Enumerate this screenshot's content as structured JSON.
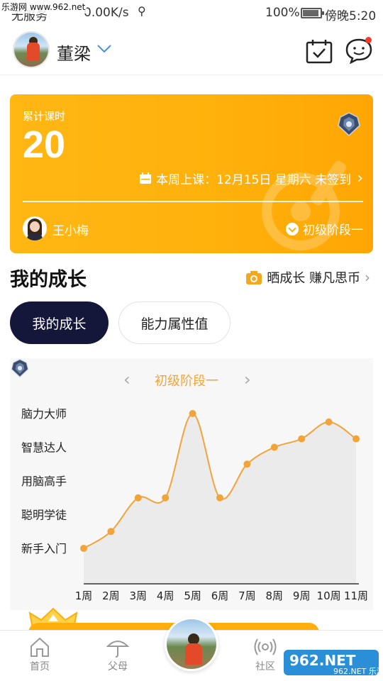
{
  "watermark_top": "乐游网 www.962.net",
  "status_bar": {
    "carrier": "无服务",
    "speed": "0.00K/s",
    "usb_icon": "usb-icon",
    "battery_pct": "100%",
    "time": "傍晚5:20"
  },
  "header": {
    "user_name": "董梁",
    "calendar_icon": "calendar-check-icon",
    "chat_icon": "chat-bubble-icon"
  },
  "card": {
    "hours_label": "累计课时",
    "hours_value": "20",
    "schedule": "本周上课：12月15日 星期六 未签到",
    "teacher_name": "王小梅",
    "stage": "初级阶段一",
    "colors": {
      "gradient_start": "#ffb714",
      "gradient_end": "#ffa604"
    }
  },
  "growth": {
    "title": "我的成长",
    "share_link": "晒成长 赚凡思币",
    "tabs": [
      {
        "label": "我的成长",
        "active": true
      },
      {
        "label": "能力属性值",
        "active": false
      }
    ]
  },
  "chart_data": {
    "type": "area",
    "title": "初级阶段一",
    "levels": [
      "新手入门",
      "聪明学徒",
      "用脑高手",
      "智慧达人",
      "脑力大师"
    ],
    "categories": [
      "1周",
      "2周",
      "3周",
      "4周",
      "5周",
      "6周",
      "7周",
      "8周",
      "9周",
      "10周",
      "11周"
    ],
    "values": [
      1.0,
      1.5,
      2.5,
      2.5,
      5.0,
      2.5,
      3.5,
      4.0,
      4.25,
      4.75,
      4.25
    ],
    "ylim": [
      1,
      5
    ],
    "grid": false,
    "colors": {
      "line": "#f0a43a",
      "fill": "#ebebeb"
    }
  },
  "tabbar": {
    "items": [
      {
        "label": "首页",
        "icon": "home-icon"
      },
      {
        "label": "父母",
        "icon": "umbrella-icon"
      },
      {
        "label": "社区",
        "icon": "broadcast-icon"
      }
    ],
    "watermark": "962.NET 乐游网"
  }
}
